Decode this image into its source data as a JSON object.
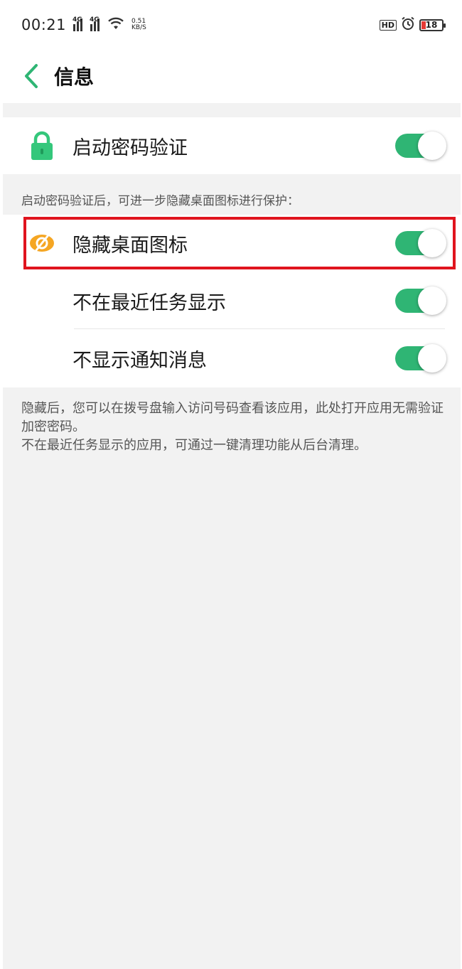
{
  "status_bar": {
    "time": "00:21",
    "signal1_tag": "4G",
    "signal2_tag": "4G",
    "speed_value": "0.51",
    "speed_unit": "KB/S",
    "hd_label": "HD",
    "battery_level": "18",
    "icons": [
      "signal-icon",
      "signal-icon",
      "wifi-icon",
      "alarm-icon",
      "battery-icon"
    ]
  },
  "header": {
    "title": "信息"
  },
  "password_section": {
    "label": "启动密码验证",
    "enabled": true,
    "icon": "lock-icon"
  },
  "hint_text": "启动密码验证后，可进一步隐藏桌面图标进行保护：",
  "options": [
    {
      "label": "隐藏桌面图标",
      "enabled": true,
      "icon": "hidden-eye-icon"
    },
    {
      "label": "不在最近任务显示",
      "enabled": true
    },
    {
      "label": "不显示通知消息",
      "enabled": true
    }
  ],
  "footnote": {
    "line1": "隐藏后，您可以在拨号盘输入访问号码查看该应用，此处打开应用无需验证加密密码。",
    "line2": "不在最近任务显示的应用，可通过一键清理功能从后台清理。"
  },
  "colors": {
    "accent": "#2fb574",
    "highlight": "#e0141e",
    "icon_orange": "#f5a623",
    "background_gray": "#f2f2f2"
  }
}
